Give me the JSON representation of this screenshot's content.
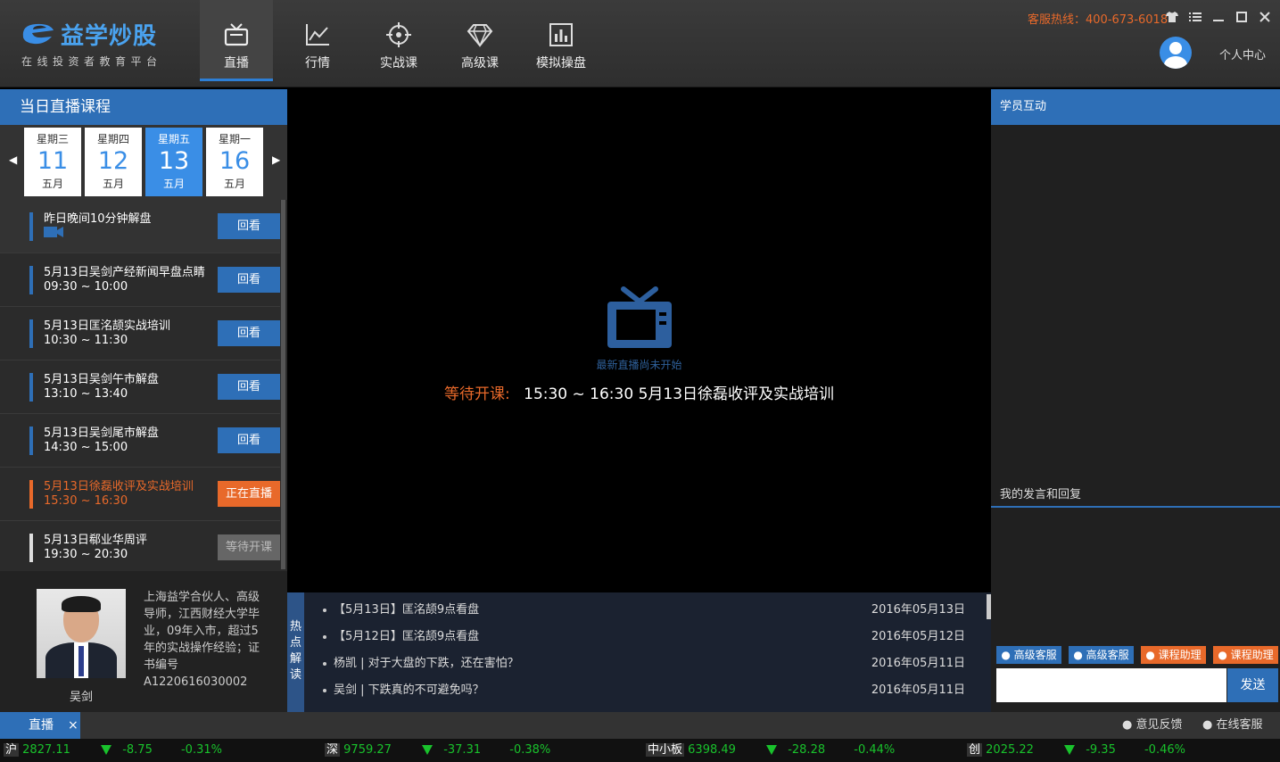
{
  "app": {
    "logo_title": "益学炒股",
    "logo_subtitle": "在线投资者教育平台",
    "hotline": "客服热线：400-673-6018",
    "user_center": "个人中心"
  },
  "nav": [
    {
      "label": "直播",
      "icon": "tv-icon",
      "active": true
    },
    {
      "label": "行情",
      "icon": "chart-line-icon"
    },
    {
      "label": "实战课",
      "icon": "crosshair-icon"
    },
    {
      "label": "高级课",
      "icon": "diamond-icon"
    },
    {
      "label": "模拟操盘",
      "icon": "bar-chart-icon"
    }
  ],
  "left": {
    "title": "当日直播课程",
    "dates": [
      {
        "weekday": "星期三",
        "day": "11",
        "month": "五月"
      },
      {
        "weekday": "星期四",
        "day": "12",
        "month": "五月"
      },
      {
        "weekday": "星期五",
        "day": "13",
        "month": "五月",
        "active": true
      },
      {
        "weekday": "星期一",
        "day": "16",
        "month": "五月"
      }
    ],
    "courses": [
      {
        "title": "昨日晚间10分钟解盘",
        "time": "",
        "button": "回看",
        "state": "replay",
        "has_camera": true
      },
      {
        "title": "5月13日吴剑产经新闻早盘点睛",
        "time": "09:30 ~ 10:00",
        "button": "回看",
        "state": "replay"
      },
      {
        "title": "5月13日匡洺颉实战培训",
        "time": "10:30 ~ 11:30",
        "button": "回看",
        "state": "replay"
      },
      {
        "title": "5月13日吴剑午市解盘",
        "time": "13:10 ~ 13:40",
        "button": "回看",
        "state": "replay"
      },
      {
        "title": "5月13日吴剑尾市解盘",
        "time": "14:30 ~ 15:00",
        "button": "回看",
        "state": "replay"
      },
      {
        "title": "5月13日徐磊收评及实战培训",
        "time": "15:30 ~ 16:30",
        "button": "正在直播",
        "state": "live"
      },
      {
        "title": "5月13日郗业华周评",
        "time": "19:30 ~ 20:30",
        "button": "等待开课",
        "state": "wait"
      }
    ],
    "teacher": {
      "name": "吴剑",
      "bio": "上海益学合伙人、高级导师，江西财经大学毕业，09年入市，超过5年的实战操作经验；证书编号A1220616030002"
    }
  },
  "video": {
    "hint": "最新直播尚未开始",
    "next_label": "等待开课:",
    "next_text": "15:30 ~ 16:30 5月13日徐磊收评及实战培训"
  },
  "hot": {
    "tab_label": "热点解读",
    "items": [
      {
        "title": "【5月13日】匡洺颉9点看盘",
        "date": "2016年05月13日"
      },
      {
        "title": "【5月12日】匡洺颉9点看盘",
        "date": "2016年05月12日"
      },
      {
        "title": "杨凯 | 对于大盘的下跌，还在害怕？",
        "date": "2016年05月11日"
      },
      {
        "title": "吴剑 | 下跌真的不可避免吗？",
        "date": "2016年05月11日"
      }
    ]
  },
  "right": {
    "title": "学员互动",
    "replies_label": "我的发言和回复",
    "service_buttons": [
      {
        "label": "高级客服",
        "color": "blue"
      },
      {
        "label": "高级客服",
        "color": "blue"
      },
      {
        "label": "课程助理",
        "color": "orange"
      },
      {
        "label": "课程助理",
        "color": "orange"
      }
    ],
    "send_label": "发送"
  },
  "bottom": {
    "tab_label": "直播",
    "close": "×",
    "feedback": "意见反馈",
    "online_service": "在线客服"
  },
  "ticker": [
    {
      "name": "沪",
      "value": "2827.11",
      "change": "-8.75",
      "pct": "-0.31%"
    },
    {
      "name": "深",
      "value": "9759.27",
      "change": "-37.31",
      "pct": "-0.38%"
    },
    {
      "name": "中小板",
      "value": "6398.49",
      "change": "-28.28",
      "pct": "-0.44%"
    },
    {
      "name": "创",
      "value": "2025.22",
      "change": "-9.35",
      "pct": "-0.46%"
    }
  ],
  "colors": {
    "brand_blue": "#2e6fb7",
    "accent_orange": "#e8692a",
    "down_green": "#19c22c"
  }
}
